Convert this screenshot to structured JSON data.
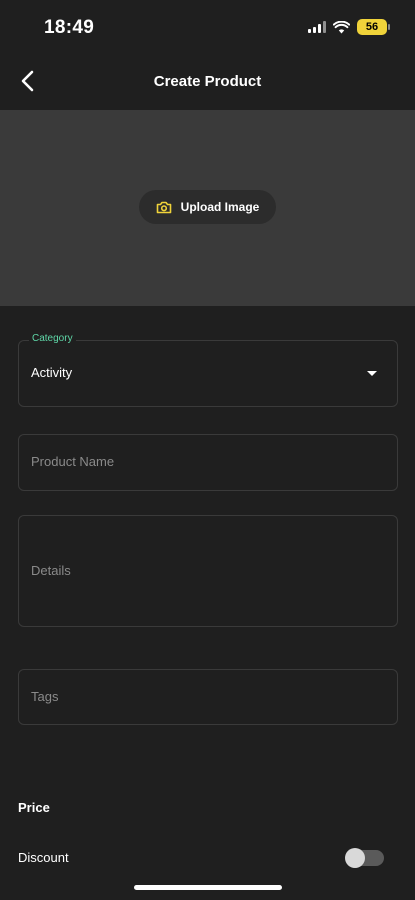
{
  "status_bar": {
    "time": "18:49",
    "battery": "56"
  },
  "nav": {
    "title": "Create Product"
  },
  "image_area": {
    "upload_label": "Upload Image"
  },
  "form": {
    "category": {
      "label": "Category",
      "value": "Activity"
    },
    "product_name": {
      "placeholder": "Product Name"
    },
    "details": {
      "placeholder": "Details"
    },
    "tags": {
      "placeholder": "Tags"
    }
  },
  "price": {
    "section_title": "Price",
    "discount_label": "Discount",
    "discount_enabled": false
  },
  "colors": {
    "accent": "#5fd7a8",
    "camera_icon": "#f0d33a"
  }
}
